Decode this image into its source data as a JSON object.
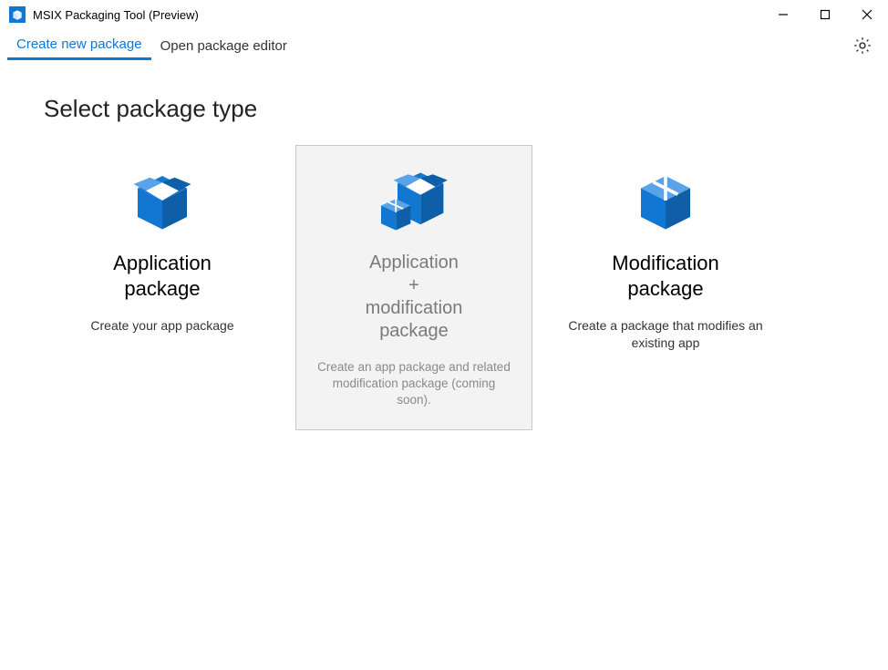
{
  "window": {
    "title": "MSIX Packaging Tool (Preview)"
  },
  "tabs": {
    "create": "Create new package",
    "open": "Open package editor"
  },
  "heading": "Select package type",
  "cards": {
    "app": {
      "title": "Application\npackage",
      "desc": "Create your app package"
    },
    "combo": {
      "title": "Application\n+\nmodification\npackage",
      "desc": "Create an app package and related modification package (coming soon)."
    },
    "mod": {
      "title": "Modification\npackage",
      "desc": "Create a package that modifies an existing app"
    }
  },
  "icons": {
    "accent": "#1276d3",
    "disabled": "#1276d3"
  }
}
